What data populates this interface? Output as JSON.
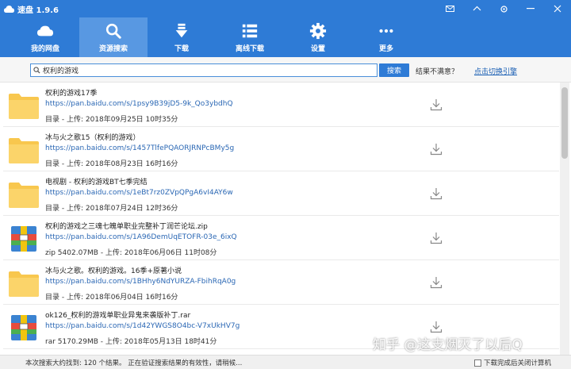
{
  "app": {
    "title": "速盘 1.9.6"
  },
  "window_controls": [
    {
      "name": "mail-icon",
      "glyph": "✉"
    },
    {
      "name": "expand-icon",
      "glyph": "⤢"
    },
    {
      "name": "settings-icon",
      "glyph": "⚙"
    },
    {
      "name": "minimize-icon",
      "glyph": "—"
    },
    {
      "name": "close-icon",
      "glyph": "✕"
    }
  ],
  "toolbar": {
    "items": [
      {
        "label": "我的网盘",
        "icon": "cloud-icon"
      },
      {
        "label": "资源搜索",
        "icon": "search-icon",
        "active": true
      },
      {
        "label": "下载",
        "icon": "download-icon"
      },
      {
        "label": "离线下载",
        "icon": "list-icon"
      },
      {
        "label": "设置",
        "icon": "gear-icon"
      },
      {
        "label": "更多",
        "icon": "more-icon"
      }
    ]
  },
  "search": {
    "value": "权利的游戏",
    "button_label": "搜索",
    "unsatisfied_text": "结果不满意？",
    "switch_link": "点击切换引擎"
  },
  "results": [
    {
      "type": "folder",
      "name": "权利的游戏17季",
      "url": "https://pan.baidu.com/s/1psy9B39jD5-9k_Qo3ybdhQ",
      "meta": "目录 - 上传: 2018年09月25日 10时35分"
    },
    {
      "type": "folder",
      "name": "冰与火之歌15（权利的游戏）",
      "url": "https://pan.baidu.com/s/1457TlfePQAORJRNPcBMy5g",
      "meta": "目录 - 上传: 2018年08月23日 16时16分"
    },
    {
      "type": "folder",
      "name": "电视剧 - 权利的游戏BT七季完结",
      "url": "https://pan.baidu.com/s/1eBt7rz0ZVpQPgA6vI4AY6w",
      "meta": "目录 - 上传: 2018年07月24日 12时36分"
    },
    {
      "type": "archive",
      "name": "权利的游戏之三魂七魄单职业完整补丁润芒论坛.zip",
      "url": "https://pan.baidu.com/s/1A96DemUqETOFR-03e_6ixQ",
      "meta": "zip 5402.07MB - 上传: 2018年06月06日 11时08分"
    },
    {
      "type": "folder",
      "name": "冰与火之歌。权利的游戏。16季+原著小说",
      "url": "https://pan.baidu.com/s/1BHhy6NdYURZA-FbihRqA0g",
      "meta": "目录 - 上传: 2018年06月04日 16时16分"
    },
    {
      "type": "archive",
      "name": "ok126_权利的游戏单职业异鬼来袭版补丁.rar",
      "url": "https://pan.baidu.com/s/1d42YWGS8O4bc-V7xUkHV7g",
      "meta": "rar 5170.29MB - 上传: 2018年05月13日 18时41分"
    }
  ],
  "status": {
    "text": "本次搜索大约找到: 120 个结果。 正在验证搜索结果的有效性，请稍候...",
    "shutdown_label": "下载完成后关闭计算机"
  },
  "watermark": "知乎 @这支烟灭了以后Q",
  "colors": {
    "primary": "#2e7bd6",
    "active_tab": "#5898e2",
    "folder": "#f8c74e",
    "link": "#2a67b4"
  }
}
